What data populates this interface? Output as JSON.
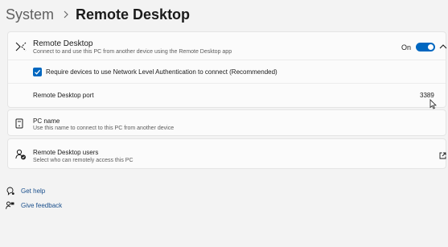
{
  "breadcrumb": {
    "root": "System",
    "current": "Remote Desktop"
  },
  "remote_desktop": {
    "title": "Remote Desktop",
    "subtitle": "Connect to and use this PC from another device using the Remote Desktop app",
    "toggle_state": "On",
    "toggle_on": true,
    "nla_checkbox_label": "Require devices to use Network Level Authentication to connect (Recommended)",
    "nla_checked": true,
    "port_label": "Remote Desktop port",
    "port_value": "3389"
  },
  "pc_name": {
    "title": "PC name",
    "subtitle": "Use this name to connect to this PC from another device"
  },
  "remote_users": {
    "title": "Remote Desktop users",
    "subtitle": "Select who can remotely access this PC"
  },
  "links": {
    "help": "Get help",
    "feedback": "Give feedback"
  },
  "icons": {
    "remote_desktop": "remote-desktop-icon",
    "expand": "chevron-up-icon",
    "pc": "pc-icon",
    "users": "person-check-icon",
    "external": "open-external-icon",
    "help": "help-icon",
    "feedback": "feedback-icon"
  },
  "colors": {
    "accent": "#0067c0",
    "background": "#f3f3f3",
    "card": "#fbfbfb"
  }
}
